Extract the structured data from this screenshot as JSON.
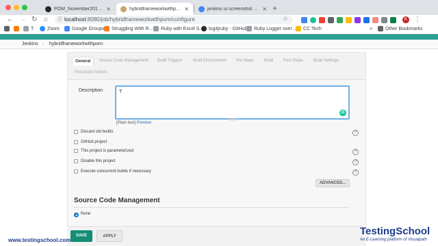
{
  "browser": {
    "tabs": [
      {
        "title": "POM_November2018Batch/pom",
        "color": "#24292e"
      },
      {
        "title": "hybridframeworkwithpom Con",
        "color": "#c9a26b"
      },
      {
        "title": "jenkins ui screenshot - Googl",
        "color": "#4285f4"
      }
    ],
    "url_host": "localhost",
    "url_path": ":8080/job/hybridframeworkwithpom/configure",
    "profile_initial": "K",
    "bookmarks": [
      {
        "label": "T",
        "color": "#3c4043"
      },
      {
        "label": "Zoom",
        "color": "#2d8cff"
      },
      {
        "label": "Google Groups",
        "color": "#4285f4"
      },
      {
        "label": "Struggling With R...",
        "color": "#f48024"
      },
      {
        "label": "Ruby with Excel S...",
        "color": "#9aa0a6"
      },
      {
        "label": "log4jruby - GitHub",
        "color": "#24292e"
      },
      {
        "label": "Ruby Logger over ...",
        "color": "#9aa0a6"
      },
      {
        "label": "CC Tech",
        "color": "#fbbc04"
      }
    ],
    "other_bookmarks": "Other Bookmarks"
  },
  "jenkins": {
    "breadcrumbs": [
      "Jenkins",
      "hybridframeworkwithpom"
    ],
    "section_tabs": [
      "General",
      "Source Code Management",
      "Build Triggers",
      "Build Environment",
      "Pre Steps",
      "Build",
      "Post Steps",
      "Build Settings",
      "Post-build Actions"
    ],
    "description_label": "Description",
    "description_value": "T",
    "plain_text": "[Plain text]",
    "preview_link": "Preview",
    "options": [
      "Discard old builds",
      "GitHub project",
      "This project is parameterized",
      "Disable this project",
      "Execute concurrent builds if necessary"
    ],
    "advanced_button": "ADVANCED...",
    "scm_title": "Source Code Management",
    "scm_option": "None",
    "save_button": "SAVE",
    "apply_button": "APPLY"
  },
  "watermark": {
    "url": "www.testingschool.com",
    "brand": "TestingSchool",
    "tagline": "An E-Learning platform of Visualpath"
  },
  "colors": {
    "jenkins_header": "#2c9e93",
    "save_button": "#138d75",
    "watermark": "#1e3c8c"
  }
}
